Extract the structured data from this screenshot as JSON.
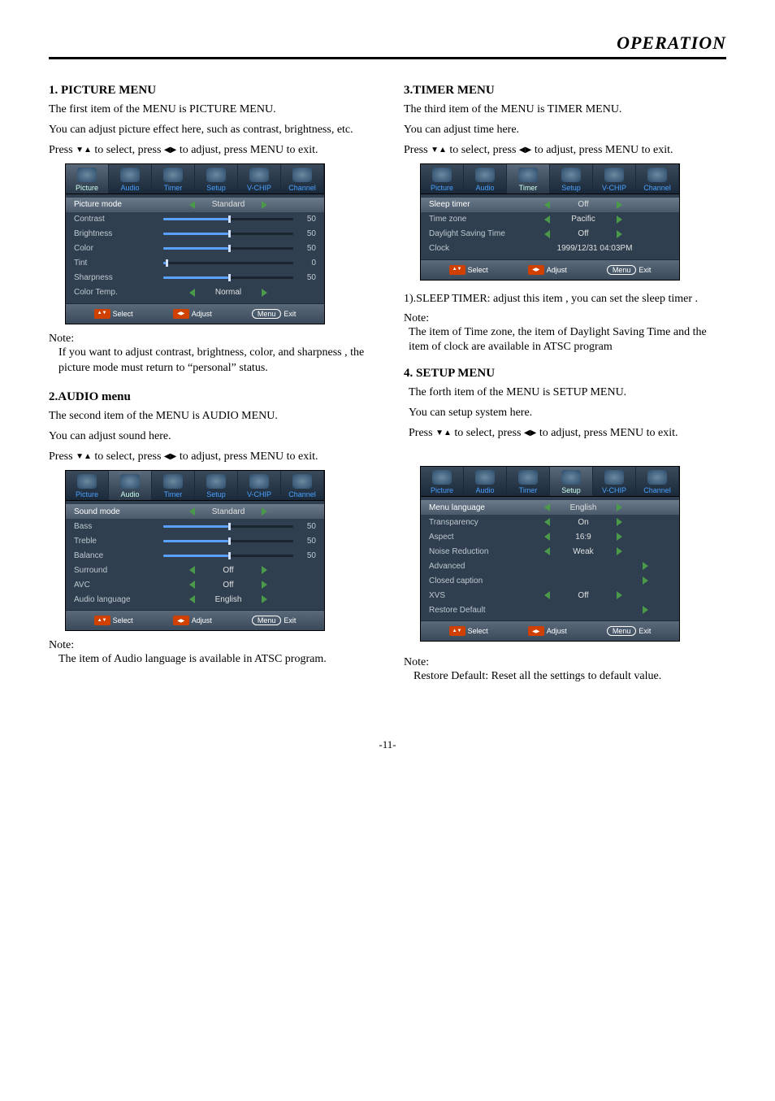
{
  "header": {
    "title": "OPERATION"
  },
  "pageNum": "-11-",
  "picture": {
    "heading": "1. PICTURE MENU",
    "p1": "The first item of the MENU is PICTURE MENU.",
    "p2": "You can adjust picture effect here, such as contrast, brightness, etc.",
    "p3a": "Press ",
    "p3b": " to select, press ",
    "p3c": " to adjust, press MENU to exit.",
    "noteLabel": "Note:",
    "note": "If you want to adjust contrast, brightness, color, and sharpness , the picture mode must return to “personal” status.",
    "osd": {
      "tabs": [
        "Picture",
        "Audio",
        "Timer",
        "Setup",
        "V-CHIP",
        "Channel"
      ],
      "activeTab": 0,
      "rows": [
        {
          "label": "Picture mode",
          "type": "select",
          "val": "Standard",
          "sel": true
        },
        {
          "label": "Contrast",
          "type": "slider",
          "val": "50"
        },
        {
          "label": "Brightness",
          "type": "slider",
          "val": "50"
        },
        {
          "label": "Color",
          "type": "slider",
          "val": "50"
        },
        {
          "label": "Tint",
          "type": "slider0",
          "val": "0"
        },
        {
          "label": "Sharpness",
          "type": "slider",
          "val": "50"
        },
        {
          "label": "Color Temp.",
          "type": "select",
          "val": "Normal"
        }
      ],
      "footer": {
        "select": "Select",
        "adjust": "Adjust",
        "menu": "Menu",
        "exit": "Exit"
      }
    }
  },
  "audio": {
    "heading": "2.AUDIO menu",
    "p1": "The second item of the MENU is AUDIO MENU.",
    "p2": "You can adjust sound here.",
    "p3a": "Press ",
    "p3b": " to select, press ",
    "p3c": " to adjust, press MENU to exit.",
    "noteLabel": "Note:",
    "note": "The item of Audio language is available in ATSC program.",
    "osd": {
      "tabs": [
        "Picture",
        "Audio",
        "Timer",
        "Setup",
        "V-CHIP",
        "Channel"
      ],
      "activeTab": 1,
      "rows": [
        {
          "label": "Sound mode",
          "type": "select",
          "val": "Standard",
          "sel": true
        },
        {
          "label": "Bass",
          "type": "slider",
          "val": "50"
        },
        {
          "label": "Treble",
          "type": "slider",
          "val": "50"
        },
        {
          "label": "Balance",
          "type": "slider",
          "val": "50"
        },
        {
          "label": "Surround",
          "type": "select",
          "val": "Off"
        },
        {
          "label": "AVC",
          "type": "select",
          "val": "Off"
        },
        {
          "label": "Audio language",
          "type": "select",
          "val": "English"
        }
      ],
      "footer": {
        "select": "Select",
        "adjust": "Adjust",
        "menu": "Menu",
        "exit": "Exit"
      }
    }
  },
  "timer": {
    "heading": "3.TIMER MENU",
    "p1": "The third item of the MENU is TIMER MENU.",
    "p2": "You can adjust time here.",
    "p3a": "Press ",
    "p3b": " to select, press ",
    "p3c": " to adjust, press MENU to exit.",
    "afterHeading": "1).SLEEP TIMER: adjust this item , you can set the sleep timer .",
    "noteLabel": "Note:",
    "note": "The item of Time zone, the item of Daylight Saving Time and the item of clock are available in ATSC program",
    "osd": {
      "tabs": [
        "Picture",
        "Audio",
        "Timer",
        "Setup",
        "V-CHIP",
        "Channel"
      ],
      "activeTab": 2,
      "rows": [
        {
          "label": "Sleep timer",
          "type": "select",
          "val": "Off",
          "sel": true
        },
        {
          "label": "Time zone",
          "type": "select",
          "val": "Pacific"
        },
        {
          "label": "Daylight Saving Time",
          "type": "select",
          "val": "Off"
        },
        {
          "label": "Clock",
          "type": "clock",
          "val": "1999/12/31 04:03PM"
        }
      ],
      "footer": {
        "select": "Select",
        "adjust": "Adjust",
        "menu": "Menu",
        "exit": "Exit"
      }
    }
  },
  "setup": {
    "heading": "4. SETUP MENU",
    "p1": "The forth item of the MENU is SETUP MENU.",
    "p2": "You can setup system here.",
    "p3a": "Press ",
    "p3b": "to select, press ",
    "p3c": " to adjust, press MENU to exit.",
    "noteLabel": "Note:",
    "note": "Restore Default: Reset all the settings to default value.",
    "osd": {
      "tabs": [
        "Picture",
        "Audio",
        "Timer",
        "Setup",
        "V-CHIP",
        "Channel"
      ],
      "activeTab": 3,
      "rows": [
        {
          "label": "Menu language",
          "type": "select",
          "val": "English",
          "sel": true
        },
        {
          "label": "Transparency",
          "type": "select",
          "val": "On"
        },
        {
          "label": "Aspect",
          "type": "select",
          "val": "16:9"
        },
        {
          "label": "Noise Reduction",
          "type": "select",
          "val": "Weak"
        },
        {
          "label": "Advanced",
          "type": "rarrow",
          "val": ""
        },
        {
          "label": "Closed caption",
          "type": "rarrow",
          "val": ""
        },
        {
          "label": "XVS",
          "type": "select",
          "val": "Off"
        },
        {
          "label": "Restore Default",
          "type": "rarrow",
          "val": ""
        }
      ],
      "footer": {
        "select": "Select",
        "adjust": "Adjust",
        "menu": "Menu",
        "exit": "Exit"
      }
    }
  }
}
